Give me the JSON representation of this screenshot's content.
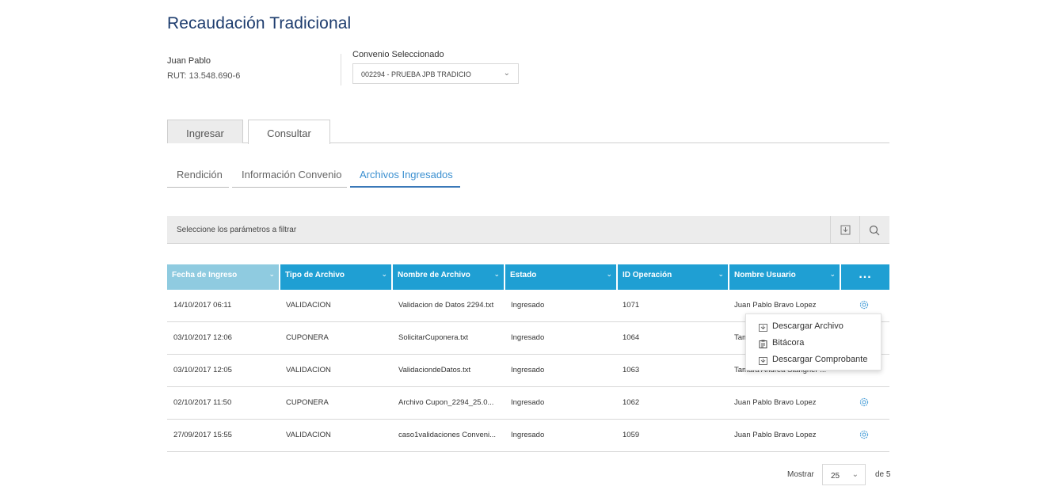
{
  "page": {
    "title": "Recaudación Tradicional"
  },
  "user": {
    "name": "Juan Pablo",
    "rut": "RUT: 13.548.690-6"
  },
  "convenio": {
    "label": "Convenio Seleccionado",
    "selected": "002294 - PRUEBA JPB TRADICIO"
  },
  "main_tabs": [
    {
      "label": "Ingresar"
    },
    {
      "label": "Consultar"
    }
  ],
  "sub_tabs": [
    {
      "label": "Rendición"
    },
    {
      "label": "Información Convenio"
    },
    {
      "label": "Archivos Ingresados",
      "active": true
    }
  ],
  "filter": {
    "placeholder": "Seleccione los parámetros a filtrar"
  },
  "table": {
    "columns": [
      "Fecha de Ingreso",
      "Tipo de Archivo",
      "Nombre de Archivo",
      "Estado",
      "ID Operación",
      "Nombre Usuario"
    ],
    "more_label": "...",
    "rows": [
      {
        "fecha": "14/10/2017 06:11",
        "tipo": "VALIDACION",
        "nombre": "Validacion de Datos 2294.txt",
        "estado": "Ingresado",
        "id": "1071",
        "usuario": "Juan Pablo Bravo Lopez"
      },
      {
        "fecha": "03/10/2017 12:06",
        "tipo": "CUPONERA",
        "nombre": "SolicitarCuponera.txt",
        "estado": "Ingresado",
        "id": "1064",
        "usuario": "Tam"
      },
      {
        "fecha": "03/10/2017 12:05",
        "tipo": "VALIDACION",
        "nombre": "ValidaciondeDatos.txt",
        "estado": "Ingresado",
        "id": "1063",
        "usuario": "Tamara Andrea Stangner ..."
      },
      {
        "fecha": "02/10/2017 11:50",
        "tipo": "CUPONERA",
        "nombre": "Archivo Cupon_2294_25.0...",
        "estado": "Ingresado",
        "id": "1062",
        "usuario": "Juan Pablo Bravo Lopez"
      },
      {
        "fecha": "27/09/2017 15:55",
        "tipo": "VALIDACION",
        "nombre": "caso1validaciones Conveni...",
        "estado": "Ingresado",
        "id": "1059",
        "usuario": "Juan Pablo Bravo Lopez"
      }
    ]
  },
  "context_menu": {
    "items": [
      {
        "label": "Descargar Archivo",
        "icon": "download-doc-icon"
      },
      {
        "label": "Bitácora",
        "icon": "clipboard-icon"
      },
      {
        "label": "Descargar Comprobante",
        "icon": "download-doc-icon"
      }
    ]
  },
  "pager": {
    "show_label": "Mostrar",
    "page_size": "25",
    "of_label": "de 5"
  },
  "colors": {
    "header_blue": "#1f9fd3",
    "header_first": "#8fcbe0",
    "title_navy": "#1d3c6e",
    "accent": "#3a8fd0"
  }
}
